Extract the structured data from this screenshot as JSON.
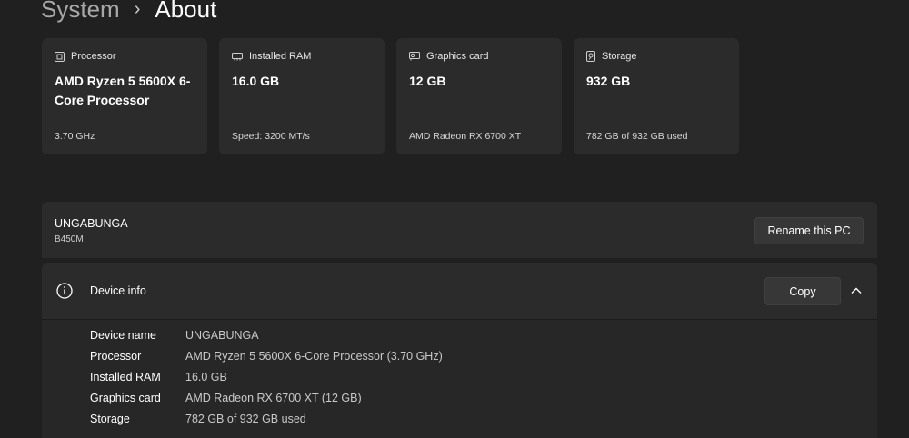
{
  "breadcrumb": {
    "parent": "System",
    "separator": "›",
    "current": "About"
  },
  "cards": [
    {
      "icon": "processor-icon",
      "label": "Processor",
      "value": "AMD Ryzen 5 5600X 6-Core Processor",
      "sub": "3.70 GHz"
    },
    {
      "icon": "ram-icon",
      "label": "Installed RAM",
      "value": "16.0 GB",
      "sub": "Speed: 3200 MT/s"
    },
    {
      "icon": "graphics-card-icon",
      "label": "Graphics card",
      "value": "12 GB",
      "sub": "AMD Radeon RX 6700 XT"
    },
    {
      "icon": "storage-icon",
      "label": "Storage",
      "value": "932 GB",
      "sub": "782 GB of 932 GB used"
    }
  ],
  "pc": {
    "name": "UNGABUNGA",
    "model": "B450M",
    "rename_label": "Rename this PC"
  },
  "device_info": {
    "title": "Device info",
    "copy_label": "Copy",
    "rows": [
      {
        "label": "Device name",
        "value": "UNGABUNGA"
      },
      {
        "label": "Processor",
        "value": "AMD Ryzen 5 5600X 6-Core Processor (3.70 GHz)"
      },
      {
        "label": "Installed RAM",
        "value": "16.0 GB"
      },
      {
        "label": "Graphics card",
        "value": "AMD Radeon RX 6700 XT (12 GB)"
      },
      {
        "label": "Storage",
        "value": "782 GB of 932 GB used"
      }
    ]
  }
}
